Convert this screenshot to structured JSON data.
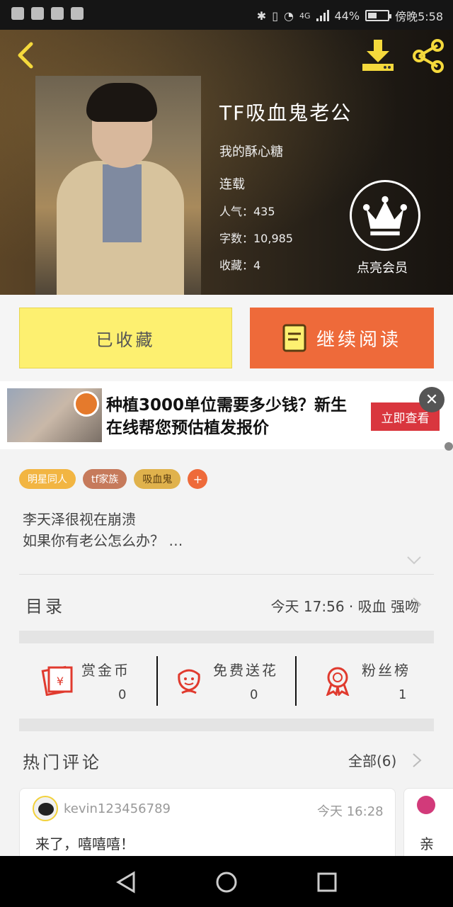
{
  "status_bar": {
    "network": "4G",
    "battery": "44%",
    "time": "傍晚5:58"
  },
  "book": {
    "title": "TF吸血鬼老公",
    "author": "我的酥心糖",
    "serial_status": "连载",
    "popularity": "人气：435",
    "words": "字数：10,985",
    "favorites": "收藏：4",
    "vip_label": "点亮会员"
  },
  "actions": {
    "collected": "已收藏",
    "continue_reading": "继续阅读"
  },
  "ad": {
    "text": "种植3000单位需要多少钱？新生在线帮您预估植发报价",
    "button": "立即查看"
  },
  "tags": [
    "明星同人",
    "tf家族",
    "吸血鬼"
  ],
  "tag_add": "+",
  "summary": {
    "line1": "李天泽很视在崩溃",
    "line2": "如果你有老公怎么办？ …"
  },
  "toc": {
    "label": "目录",
    "latest": "今天 17:56 · 吸血 强吻"
  },
  "stats": {
    "coins_label": "赏金币",
    "coins_value": "0",
    "flowers_label": "免费送花",
    "flowers_value": "0",
    "fans_label": "粉丝榜",
    "fans_value": "1"
  },
  "comments": {
    "label": "热门评论",
    "all": "全部(6)",
    "items": [
      {
        "user": "kevin123456789",
        "time": "今天 16:28",
        "text": "来了，嘻嘻嘻！"
      },
      {
        "user": "",
        "time": "",
        "text": "亲"
      }
    ]
  },
  "colors": {
    "accent_orange": "#ee6a3a",
    "collected_yellow": "#fdf070",
    "ad_red": "#d9363e",
    "icon_red": "#e03a2e"
  }
}
